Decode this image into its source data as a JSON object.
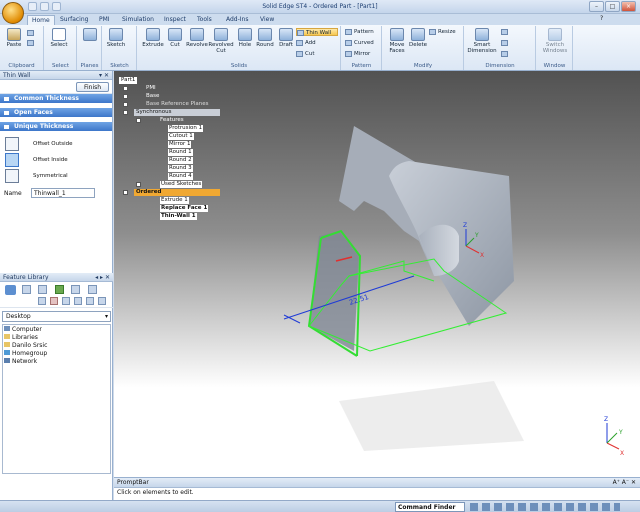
{
  "window": {
    "title": "Solid Edge ST4 - Ordered Part - [Part1]"
  },
  "tabs": [
    "Home",
    "Surfacing",
    "PMI",
    "Simulation",
    "Inspect",
    "Tools",
    "Add-Ins",
    "View"
  ],
  "ribbon": {
    "clipboard": {
      "label": "Clipboard",
      "paste": "Paste"
    },
    "select": {
      "label": "Select",
      "select": "Select"
    },
    "planes": {
      "label": "Planes"
    },
    "sketch": {
      "label": "Sketch",
      "sketch": "Sketch"
    },
    "solids": {
      "label": "Solids",
      "extrude": "Extrude",
      "cut": "Cut",
      "revolve": "Revolve",
      "revolved_cut": "Revolved Cut",
      "hole": "Hole",
      "round": "Round",
      "draft": "Draft",
      "thin_wall": "Thin Wall",
      "add": "Add",
      "cut_small": "Cut"
    },
    "pattern": {
      "label": "Pattern",
      "pattern": "Pattern",
      "curved": "Curved",
      "mirror": "Mirror"
    },
    "modify": {
      "label": "Modify",
      "move_faces": "Move Faces",
      "delete": "Delete",
      "resize": "Resize"
    },
    "dimension": {
      "label": "Dimension",
      "smart_dimension": "Smart Dimension"
    },
    "window": {
      "label": "Window",
      "switch_windows": "Switch Windows"
    }
  },
  "thin_wall": {
    "title": "Thin Wall",
    "finish": "Finish",
    "sections": [
      "Common Thickness",
      "Open Faces",
      "Unique Thickness"
    ],
    "options": [
      "Offset Outside",
      "Offset Inside",
      "Symmetrical"
    ],
    "name_label": "Name",
    "name_value": "Thinwall_1"
  },
  "feature_library": {
    "title": "Feature Library",
    "location": "Desktop",
    "items": [
      "Computer",
      "Libraries",
      "Danilo Srsic",
      "Homegroup",
      "Network"
    ]
  },
  "pathfinder": {
    "part": "Part1",
    "items": [
      "PMI",
      "Base",
      "Base Reference Planes",
      "Synchronous",
      "Features",
      "Protrusion 1",
      "Cutout 1",
      "Mirror 1",
      "Round 1",
      "Round 2",
      "Round 3",
      "Round 4",
      "Used Sketches",
      "Ordered",
      "Extrude 1",
      "Replace Face 1",
      "Thin-Wall 1"
    ]
  },
  "axes": {
    "x": "X",
    "y": "Y",
    "z": "Z"
  },
  "dimension_value": "22.51",
  "prompt": {
    "title": "PromptBar",
    "text": "Click on elements to edit."
  },
  "status": {
    "command_finder": "Command Finder"
  },
  "colors": {
    "accent": "#3d77c9",
    "highlight": "#f0a832",
    "edge": "#33dd33"
  }
}
